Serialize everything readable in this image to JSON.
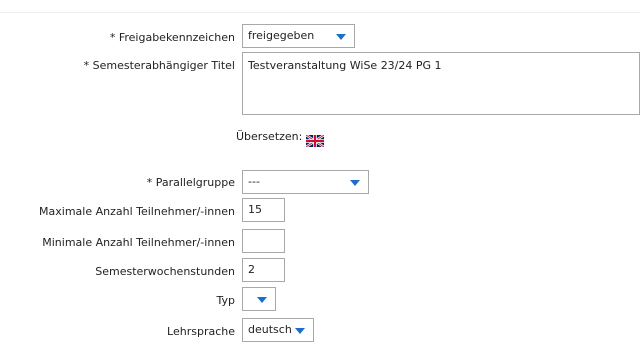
{
  "form": {
    "freigabe": {
      "label": "* Freigabekennzeichen",
      "value": "freigegeben",
      "icon": "chevron-down-icon"
    },
    "title": {
      "label": "* Semesterabhängiger Titel",
      "value": "Testveranstaltung WiSe 23/24 PG 1"
    },
    "translate": {
      "label": "Übersetzen:",
      "flag_icon": "uk-flag-icon"
    },
    "parallelgruppe": {
      "label": "* Parallelgruppe",
      "value": "---",
      "icon": "chevron-down-icon"
    },
    "max_participants": {
      "label": "Maximale Anzahl Teilnehmer/-innen",
      "value": "15"
    },
    "min_participants": {
      "label": "Minimale Anzahl Teilnehmer/-innen",
      "value": ""
    },
    "sws": {
      "label": "Semesterwochenstunden",
      "value": "2"
    },
    "typ": {
      "label": "Typ",
      "value": "",
      "icon": "chevron-down-icon"
    },
    "lehrsprache": {
      "label": "Lehrsprache",
      "value": "deutsch",
      "icon": "chevron-down-icon"
    }
  },
  "colors": {
    "accent": "#1a6fc9",
    "border": "#a9a9a9"
  }
}
